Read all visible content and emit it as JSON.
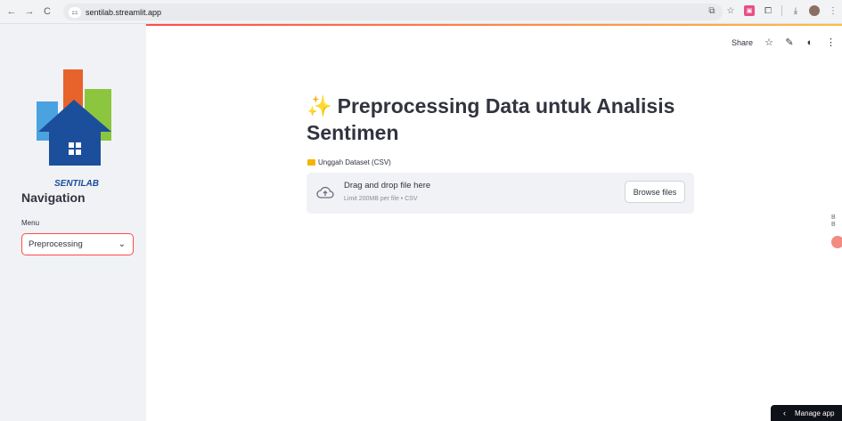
{
  "browser": {
    "url": "sentilab.streamlit.app",
    "back": "←",
    "forward": "→",
    "reload": "C",
    "site_icon": "⚏"
  },
  "toolbar": {
    "share_label": "Share",
    "star_icon": "☆",
    "edit_icon": "✎",
    "github_icon": "◐",
    "more_icon": "⋮"
  },
  "sidebar": {
    "logo_text": "SENTILAB",
    "nav_title": "Navigation",
    "menu_label": "Menu",
    "selected_option": "Preprocessing"
  },
  "main": {
    "title_icon": "✨",
    "title": "Preprocessing Data untuk Analisis Sentimen",
    "upload_label": "Unggah Dataset (CSV)",
    "dropzone_text": "Drag and drop file here",
    "dropzone_limit": "Limit 200MB per file • CSV",
    "browse_label": "Browse files"
  },
  "footer": {
    "manage_app_label": "Manage app"
  },
  "colors": {
    "accent": "#ff4b4b",
    "sidebar_bg": "#f0f2f6",
    "text": "#31333f"
  }
}
